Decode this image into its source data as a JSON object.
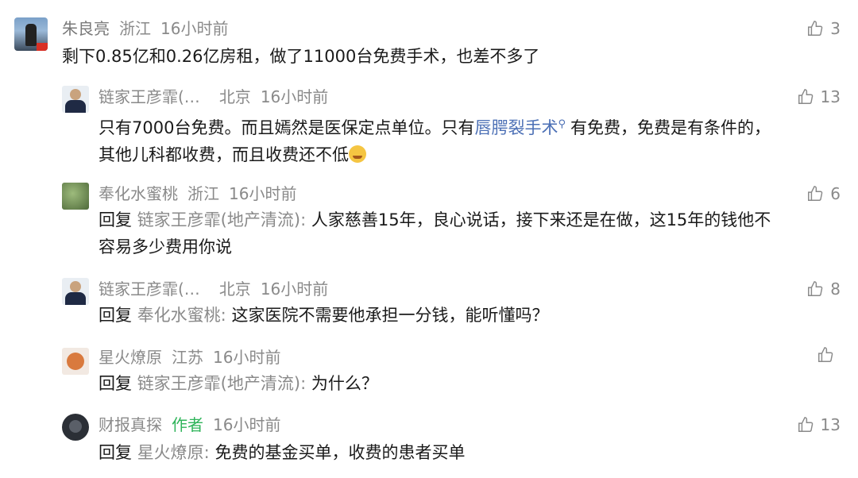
{
  "comments": [
    {
      "username": "朱良亮",
      "location": "浙江",
      "time": "16小时前",
      "likes": "3",
      "text": "剩下0.85亿和0.26亿房租，做了11000台免费手术，也差不多了"
    },
    {
      "username": "链家王彦霏(…",
      "location": "北京",
      "time": "16小时前",
      "likes": "13",
      "text_part1": "只有7000台免费。而且嫣然是医保定点单位。只有",
      "link_text": "唇腭裂手术",
      "text_part2": "有免费，免费是有条件的，",
      "text_line2": "其他儿科都收费，而且收费还不低"
    },
    {
      "username": "奉化水蜜桃",
      "location": "浙江",
      "time": "16小时前",
      "likes": "6",
      "reply_keyword": "回复",
      "reply_target": "链家王彦霏(地产清流):",
      "text_line1": "人家慈善15年，良心说话，接下来还是在做，这15年的钱他不",
      "text_line2": "容易多少费用你说"
    },
    {
      "username": "链家王彦霏(…",
      "location": "北京",
      "time": "16小时前",
      "likes": "8",
      "reply_keyword": "回复",
      "reply_target": "奉化水蜜桃:",
      "text": "这家医院不需要他承担一分钱，能听懂吗？"
    },
    {
      "username": "星火燎原",
      "location": "江苏",
      "time": "16小时前",
      "likes": "",
      "reply_keyword": "回复",
      "reply_target": "链家王彦霏(地产清流):",
      "text": "为什么？"
    },
    {
      "username": "财报真探",
      "author_tag": "作者",
      "time": "16小时前",
      "likes": "13",
      "reply_keyword": "回复",
      "reply_target": "星火燎原:",
      "text": "免费的基金买单，收费的患者买单"
    }
  ],
  "icons": {
    "like": "thumbs-up-icon",
    "search": "search-icon",
    "emoji": "laughing-emoji-icon"
  },
  "colors": {
    "meta_gray": "#8a8a8a",
    "link_blue": "#4b6fb5",
    "author_green": "#2fb45a"
  }
}
